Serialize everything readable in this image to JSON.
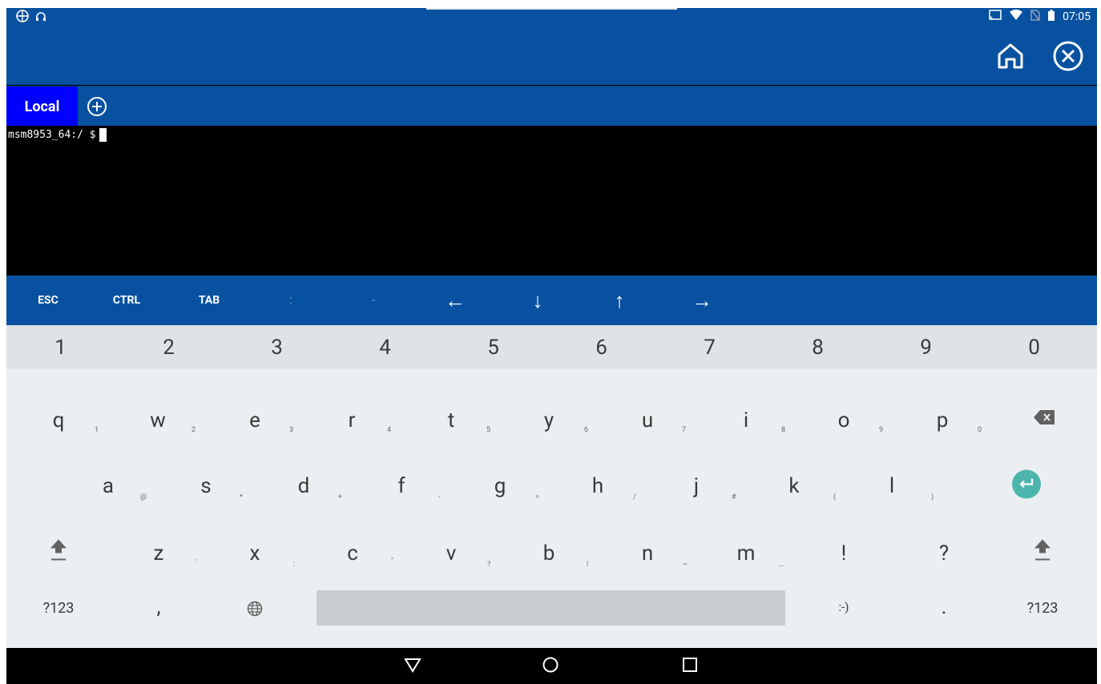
{
  "status_bar": {
    "time": "07:05",
    "left_icons": [
      "app-icon",
      "headset-icon"
    ],
    "right_icons": [
      "cast-icon",
      "wifi-icon",
      "no-sim-icon",
      "battery-icon"
    ]
  },
  "app_bar": {
    "icons": [
      "home-icon",
      "close-circle-icon"
    ]
  },
  "tabs": {
    "items": [
      {
        "label": "Local",
        "active": true
      }
    ],
    "add_icon": "add-circle-icon"
  },
  "terminal": {
    "prompt": "msm8953_64:/ $"
  },
  "extra_keys": [
    "ESC",
    "CTRL",
    "TAB",
    ":",
    "-",
    "←",
    "↓",
    "↑",
    "→"
  ],
  "keyboard": {
    "number_row": [
      "1",
      "2",
      "3",
      "4",
      "5",
      "6",
      "7",
      "8",
      "9",
      "0"
    ],
    "row1": [
      {
        "key": "q",
        "hint": "1"
      },
      {
        "key": "w",
        "hint": "2"
      },
      {
        "key": "e",
        "hint": "3"
      },
      {
        "key": "r",
        "hint": "4"
      },
      {
        "key": "t",
        "hint": "5"
      },
      {
        "key": "y",
        "hint": "6"
      },
      {
        "key": "u",
        "hint": "7"
      },
      {
        "key": "i",
        "hint": "8"
      },
      {
        "key": "o",
        "hint": "9"
      },
      {
        "key": "p",
        "hint": "0"
      }
    ],
    "row2": [
      {
        "key": "a",
        "hint": "@"
      },
      {
        "key": "s",
        "hint": "*"
      },
      {
        "key": "d",
        "hint": "+"
      },
      {
        "key": "f",
        "hint": "-"
      },
      {
        "key": "g",
        "hint": "="
      },
      {
        "key": "h",
        "hint": "/"
      },
      {
        "key": "j",
        "hint": "#"
      },
      {
        "key": "k",
        "hint": "("
      },
      {
        "key": "l",
        "hint": ")"
      }
    ],
    "row3": [
      {
        "key": "z",
        "hint": "'"
      },
      {
        "key": "x",
        "hint": ":"
      },
      {
        "key": "c",
        "hint": "\""
      },
      {
        "key": "v",
        "hint": "?"
      },
      {
        "key": "b",
        "hint": "!"
      },
      {
        "key": "n",
        "hint": "~"
      },
      {
        "key": "m",
        "hint": "…"
      },
      {
        "key": "!",
        "hint": ""
      },
      {
        "key": "?",
        "hint": ""
      }
    ],
    "bottom": {
      "symbols_left": "?123",
      "comma": ",",
      "emoticon": ":-)",
      "period": ".",
      "symbols_right": "?123"
    },
    "accent_color": "#4db6ac"
  },
  "nav_bar": {
    "icons": [
      "back-icon",
      "home-circle-icon",
      "recents-icon"
    ]
  },
  "colors": {
    "app_blue": "#0751a0",
    "tab_active": "#0000ff",
    "terminal_bg": "#000000"
  }
}
